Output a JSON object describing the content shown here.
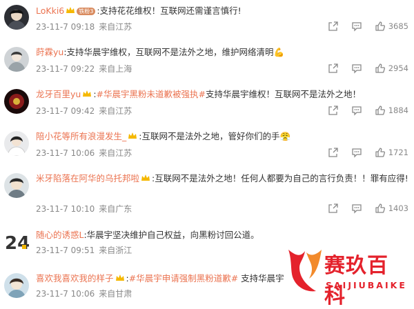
{
  "comments": [
    {
      "user": "LoKki6",
      "vip_badge": "铁粉3",
      "segments": [
        {
          "text": ":支持花花维权！互联网还需谨言慎行!",
          "topic": false
        }
      ],
      "date": "23-11-7 09:18",
      "location": "来自江苏",
      "likes": "3685"
    },
    {
      "user": "莳霖yu",
      "segments": [
        {
          "text": ":支持华晨宇维权，互联网不是法外之地，维护网络清明💪",
          "topic": false
        }
      ],
      "date": "23-11-7 09:22",
      "location": "来自上海",
      "likes": "2954"
    },
    {
      "user": "龙牙百里yu",
      "segments": [
        {
          "text": ":",
          "topic": false
        },
        {
          "text": "#华晨宇黑粉未道歉被强执#",
          "topic": true
        },
        {
          "text": "支持华晨宇维权！互联网不是法外之地！",
          "topic": false
        }
      ],
      "date": "23-11-7 09:42",
      "location": "来自江苏",
      "likes": "1884"
    },
    {
      "user": "陪小花等所有浪漫发生_",
      "segments": [
        {
          "text": ":互联网不是法外之地，管好你们的手😤",
          "topic": false
        }
      ],
      "date": "23-11-7 10:06",
      "location": "来自江苏",
      "likes": "1721"
    },
    {
      "user": "米牙陷落在阿华的乌托邦啦",
      "segments": [
        {
          "text": ":互联网不是法外之地！任何人都要为自己的言行负责！！罪有应得!",
          "topic": false
        }
      ],
      "date": "23-11-7 10:10",
      "location": "来自广东",
      "likes": "1403"
    },
    {
      "user": "随心的诱惑L",
      "segments": [
        {
          "text": ":华晨宇坚决维护自己权益，向黑粉讨回公道。",
          "topic": false
        }
      ],
      "date": "23-11-7 09:51",
      "location": "来自浙江",
      "likes": ""
    },
    {
      "user": "喜欢我喜欢我的样子",
      "segments": [
        {
          "text": ":",
          "topic": false
        },
        {
          "text": "#华晨宇申请强制黑粉道歉#",
          "topic": true
        },
        {
          "text": " 支持华晨宇",
          "topic": false
        }
      ],
      "date": "23-11-7 10:06",
      "location": "来自甘肃",
      "likes": ""
    }
  ],
  "watermark": {
    "title": "赛玖百科",
    "subtitle": "SAIJIUBAIKE"
  },
  "icons": {
    "share": "share-icon",
    "comment": "comment-icon",
    "like": "thumbs-up-icon"
  },
  "colors": {
    "username": "#eb7350",
    "meta": "#888888",
    "watermark": "#e4222c"
  }
}
